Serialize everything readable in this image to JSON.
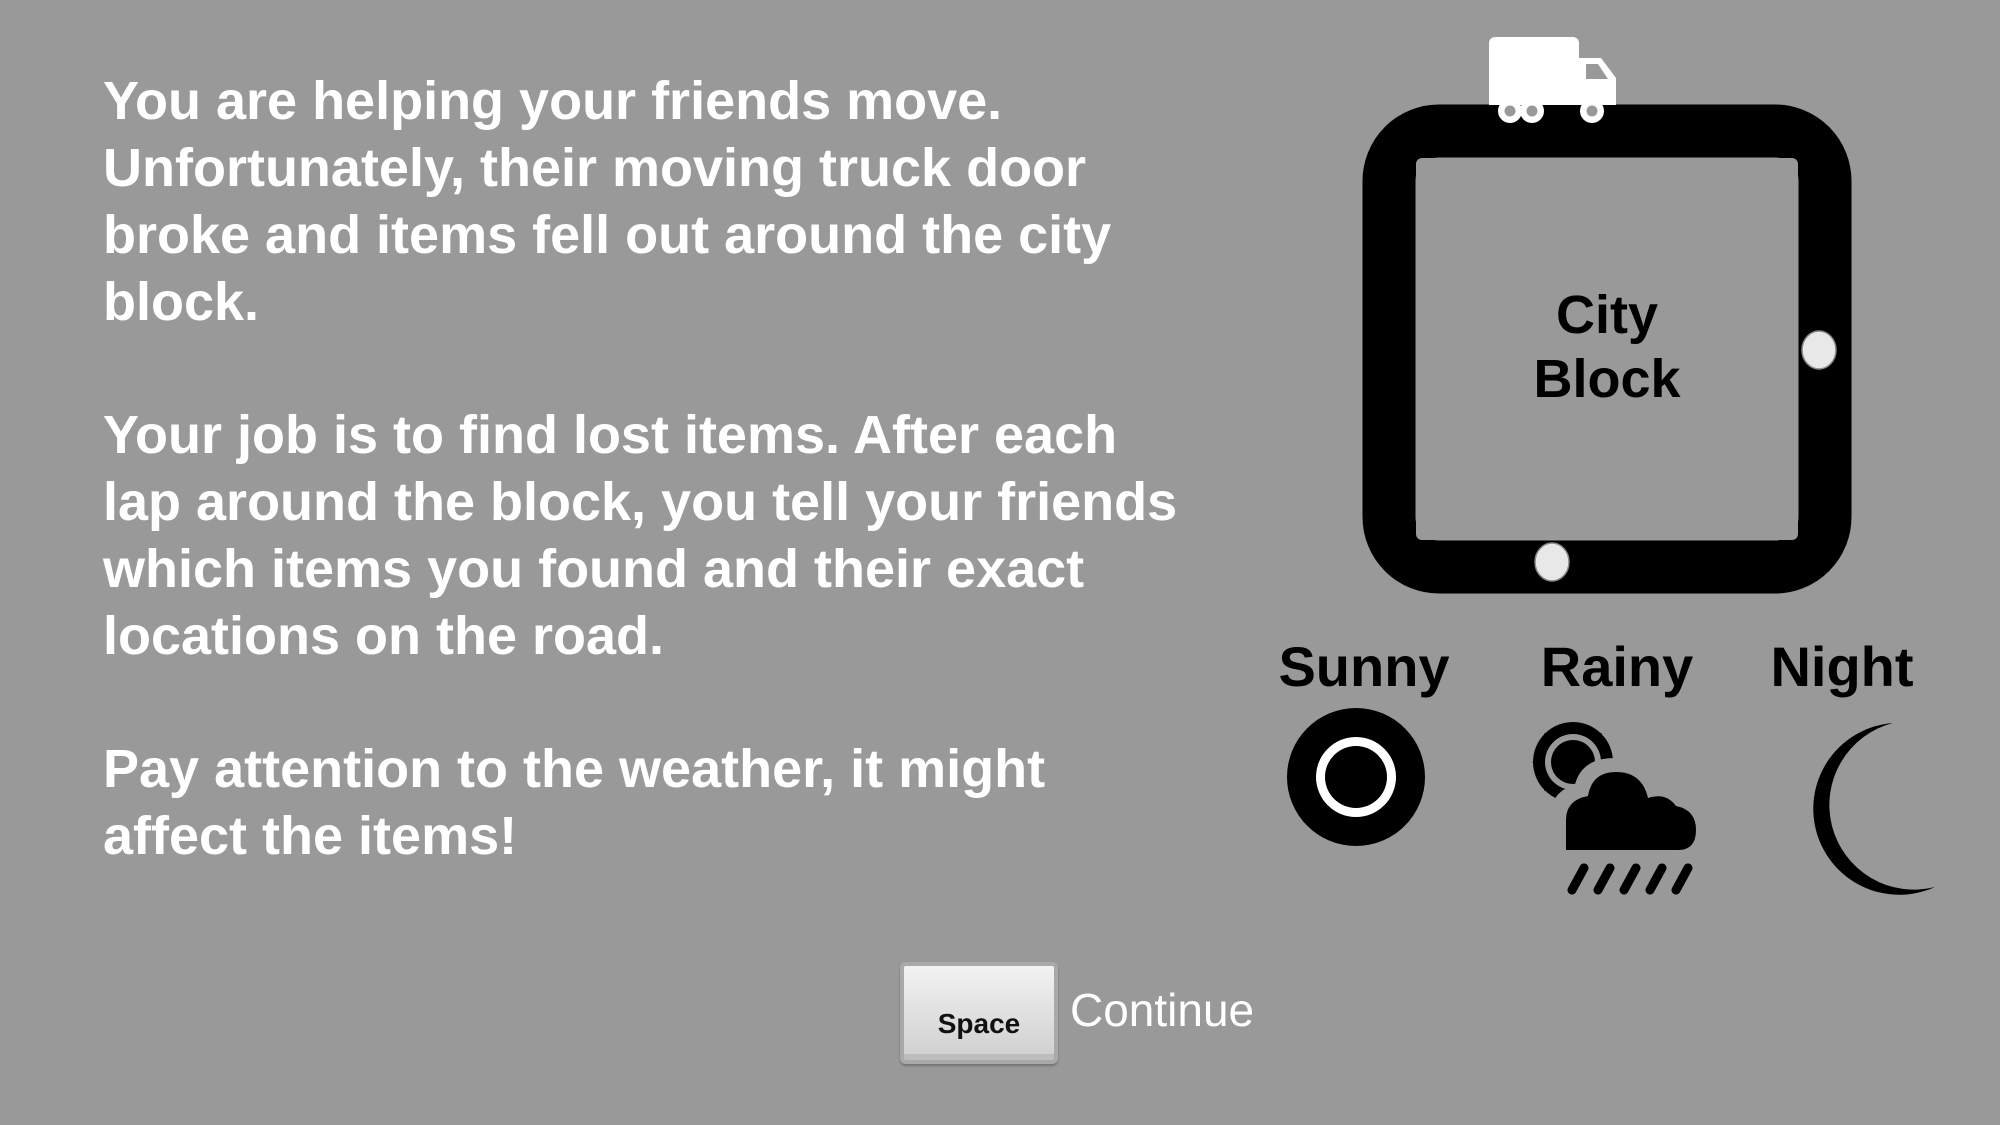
{
  "instructions": {
    "paragraph1": "You are helping your friends move.\nUnfortunately, their moving truck door\nbroke and items fell out around the city\nblock.",
    "paragraph2": "Your job is to find lost items. After each\nlap around the block, you tell your friends\nwhich items you found and their exact\nlocations on the road.",
    "paragraph3": "Pay attention to the weather, it might\naffect the items!"
  },
  "city_block": {
    "label_line1": "City",
    "label_line2": "Block"
  },
  "weather": [
    {
      "label": "Sunny",
      "icon": "sun-icon"
    },
    {
      "label": "Rainy",
      "icon": "sun-cloud-rain-icon"
    },
    {
      "label": "Night",
      "icon": "moon-icon"
    }
  ],
  "controls": {
    "key_label": "Space",
    "action_label": "Continue"
  },
  "colors": {
    "background": "#999999",
    "text": "#ffffff",
    "diagram": "#000000"
  }
}
